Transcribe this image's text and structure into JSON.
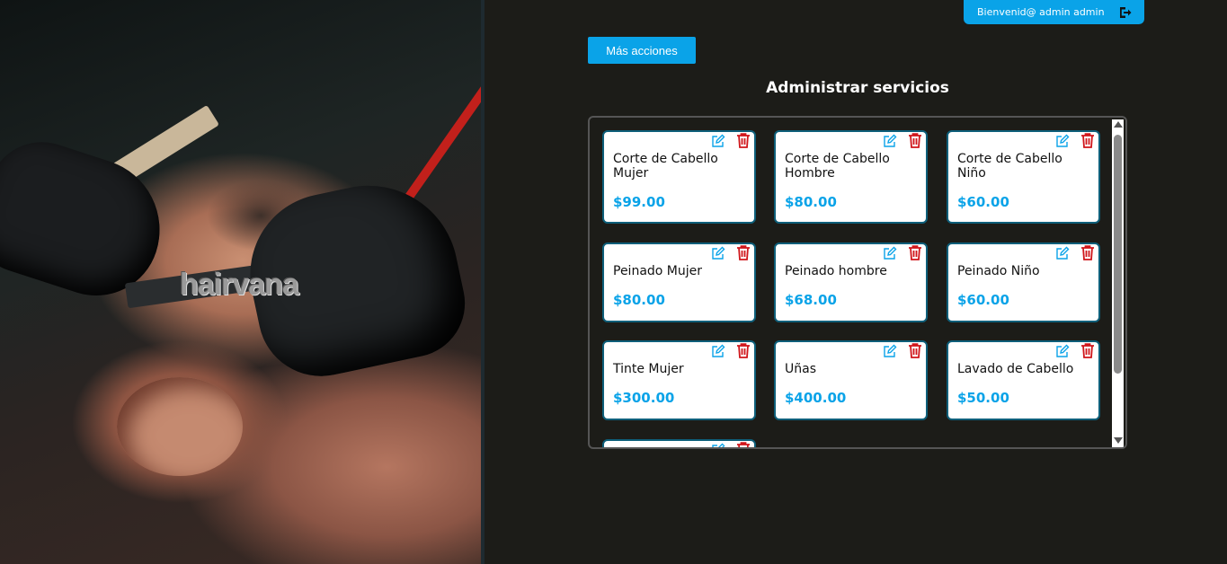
{
  "hero": {
    "logo_text": "hairvana"
  },
  "header": {
    "welcome_text": "Bienvenid@ admin admin",
    "logout_icon": "logout-icon"
  },
  "actions": {
    "more_label": "Más acciones"
  },
  "main": {
    "title": "Administrar servicios"
  },
  "colors": {
    "accent": "#0aa3e8",
    "delete": "#d0161b",
    "background": "#1c1c18"
  },
  "services": [
    {
      "name": "Corte de Cabello Mujer",
      "price": "$99.00"
    },
    {
      "name": "Corte de Cabello Hombre",
      "price": "$80.00"
    },
    {
      "name": "Corte de Cabello Niño",
      "price": "$60.00"
    },
    {
      "name": "Peinado Mujer",
      "price": "$80.00"
    },
    {
      "name": "Peinado hombre",
      "price": "$68.00"
    },
    {
      "name": "Peinado Niño",
      "price": "$60.00"
    },
    {
      "name": "Tinte Mujer",
      "price": "$300.00"
    },
    {
      "name": "Uñas",
      "price": "$400.00"
    },
    {
      "name": "Lavado de Cabello",
      "price": "$50.00"
    },
    {
      "name": "",
      "price": ""
    }
  ]
}
